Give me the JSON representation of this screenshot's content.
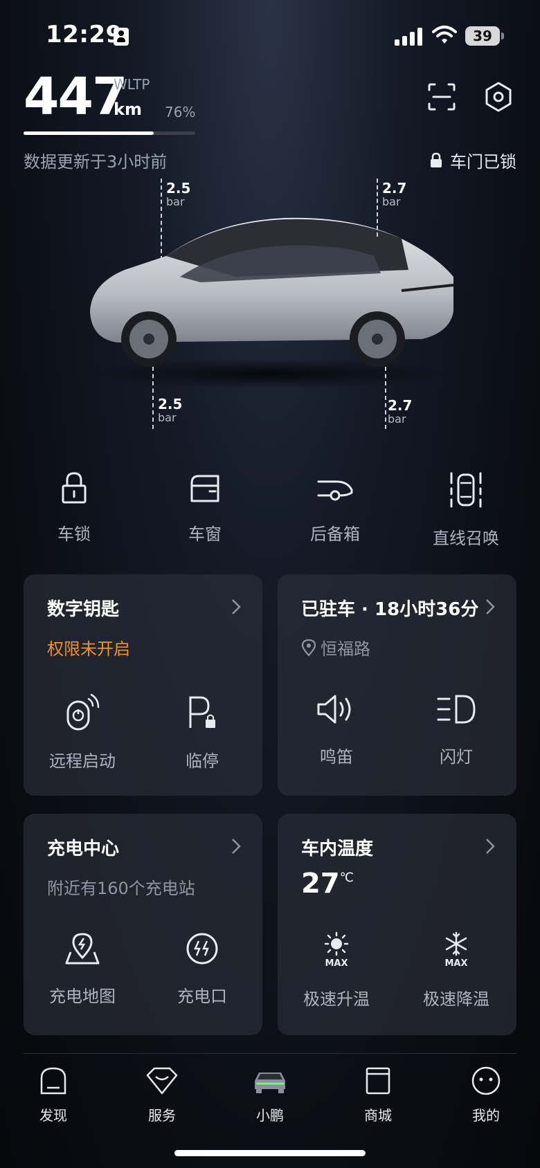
{
  "status_bar": {
    "time": "12:29",
    "battery": "39"
  },
  "range": {
    "value": "447",
    "standard": "WLTP",
    "unit": "km",
    "battery_percent": "76%",
    "battery_level": 0.76
  },
  "update_text": "数据更新于3小时前",
  "lock_status": "车门已锁",
  "tires": {
    "front_left": {
      "value": "2.5",
      "unit": "bar"
    },
    "rear_left": {
      "value": "2.7",
      "unit": "bar"
    },
    "front_right": {
      "value": "2.5",
      "unit": "bar"
    },
    "rear_right": {
      "value": "2.7",
      "unit": "bar"
    }
  },
  "quick_actions": [
    {
      "label": "车锁",
      "icon": "lock-icon"
    },
    {
      "label": "车窗",
      "icon": "window-icon"
    },
    {
      "label": "后备箱",
      "icon": "trunk-icon"
    },
    {
      "label": "直线召唤",
      "icon": "summon-icon"
    }
  ],
  "cards": {
    "digital_key": {
      "title": "数字钥匙",
      "status": "权限未开启",
      "actions": [
        "远程启动",
        "临停"
      ]
    },
    "parking": {
      "title": "已驻车 · 18小时36分",
      "location": "恒福路",
      "actions": [
        "鸣笛",
        "闪灯"
      ]
    },
    "charging": {
      "title": "充电中心",
      "subtitle": "附近有160个充电站",
      "actions": [
        "充电地图",
        "充电口"
      ]
    },
    "cabin_temp": {
      "title": "车内温度",
      "temperature": "27",
      "unit": "℃",
      "actions": [
        "极速升温",
        "极速降温"
      ],
      "max_label": "MAX"
    }
  },
  "tabs": [
    {
      "label": "发现",
      "icon": "discover-icon"
    },
    {
      "label": "服务",
      "icon": "service-icon"
    },
    {
      "label": "小鹏",
      "icon": "car-icon",
      "active": true
    },
    {
      "label": "商城",
      "icon": "shop-icon"
    },
    {
      "label": "我的",
      "icon": "profile-icon"
    }
  ],
  "colors": {
    "accent_orange": "#f0912f",
    "active_green": "#7cf08a"
  }
}
